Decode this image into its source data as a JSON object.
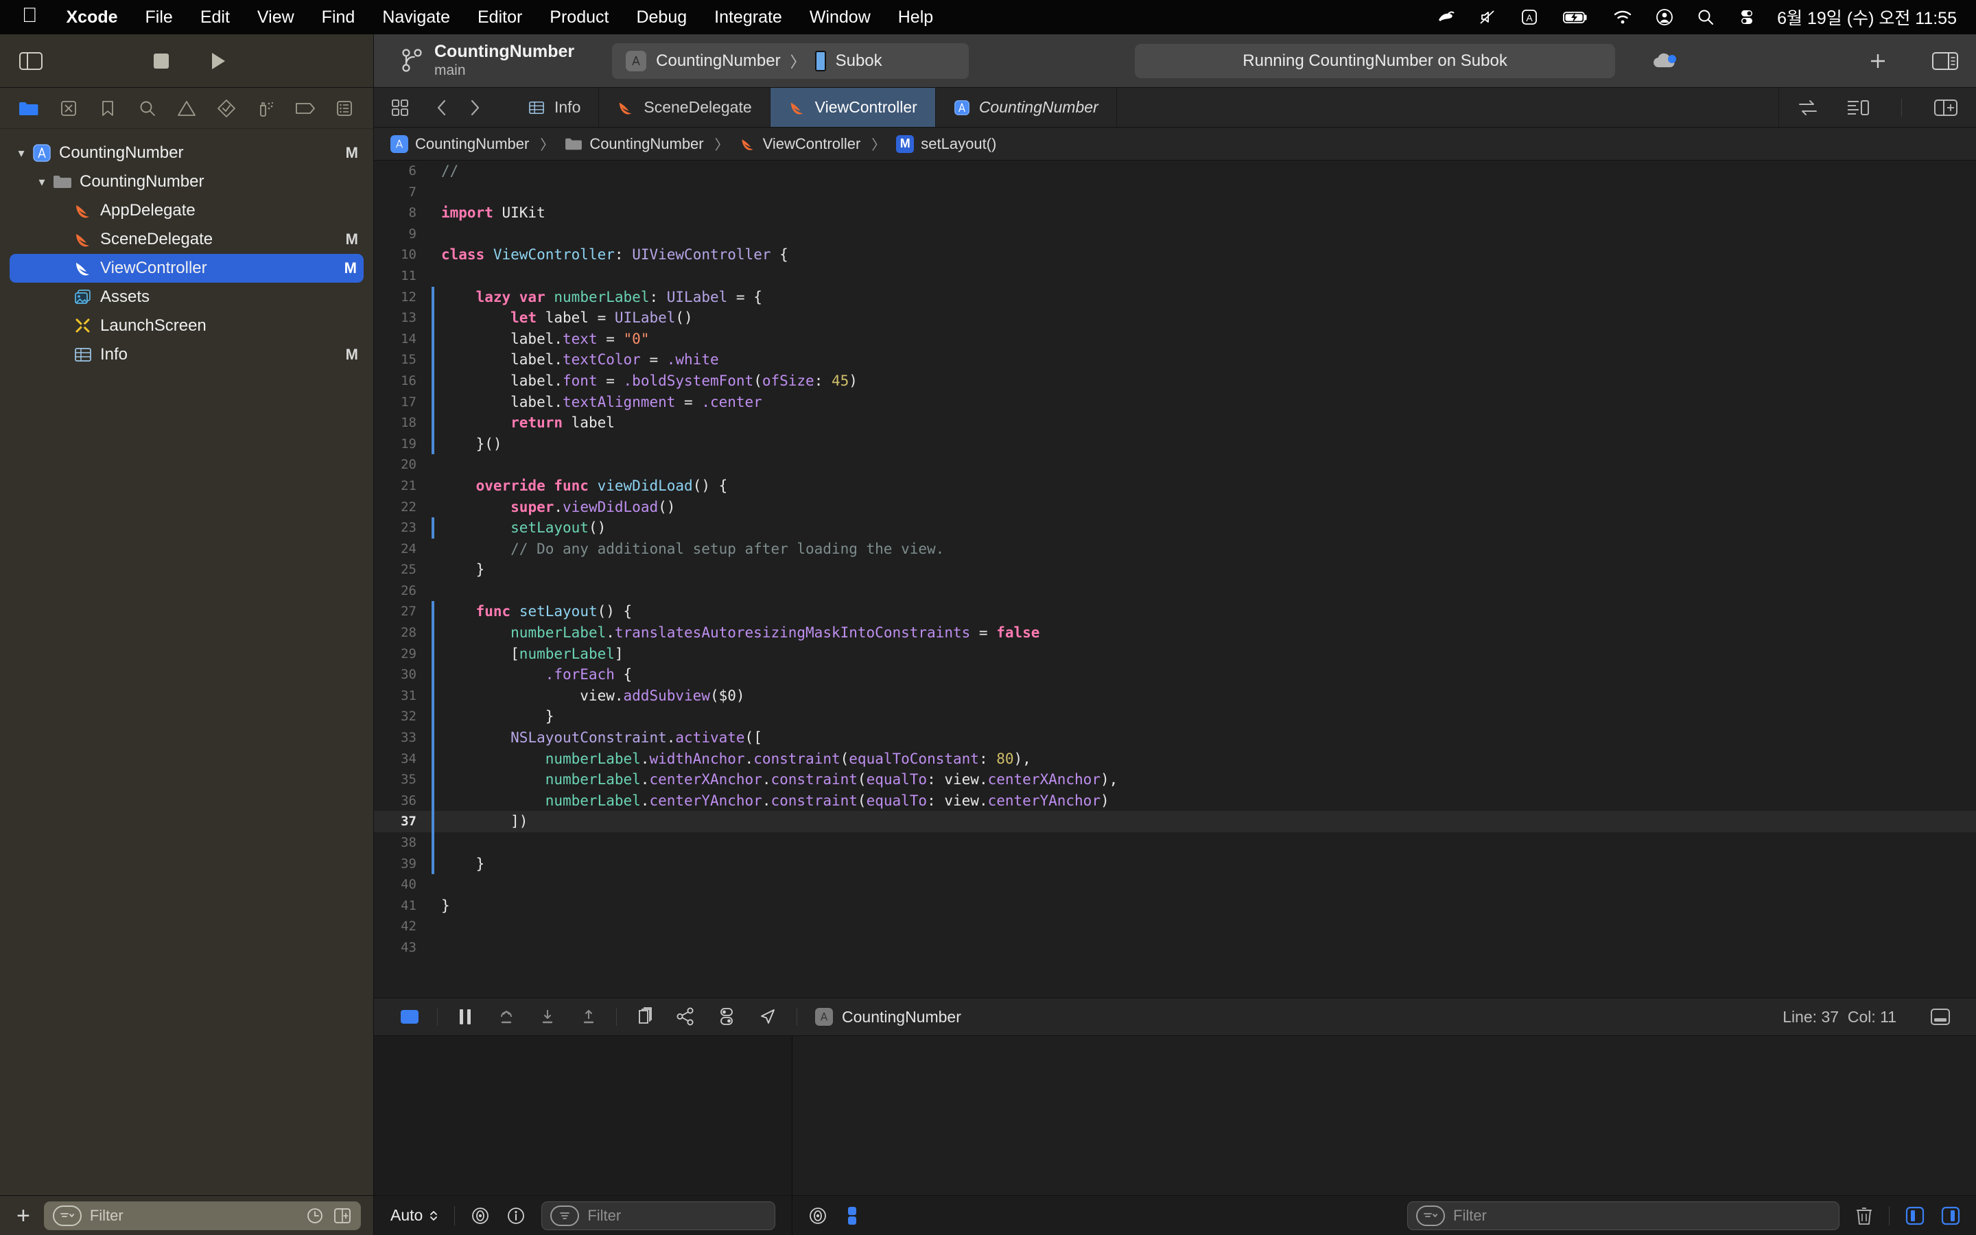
{
  "menubar": {
    "apple_icon": "apple-icon",
    "items": [
      {
        "label": "Xcode",
        "bold": true
      },
      {
        "label": "File",
        "bold": false
      },
      {
        "label": "Edit",
        "bold": false
      },
      {
        "label": "View",
        "bold": false
      },
      {
        "label": "Find",
        "bold": false
      },
      {
        "label": "Navigate",
        "bold": false
      },
      {
        "label": "Editor",
        "bold": false
      },
      {
        "label": "Product",
        "bold": false
      },
      {
        "label": "Debug",
        "bold": false
      },
      {
        "label": "Integrate",
        "bold": false
      },
      {
        "label": "Window",
        "bold": false
      },
      {
        "label": "Help",
        "bold": false
      }
    ],
    "status_icons": [
      "app-status-icon",
      "volume-mute-icon",
      "input-source-a-icon",
      "battery-charging-icon",
      "wifi-icon",
      "user-account-icon",
      "spotlight-search-icon",
      "control-center-icon"
    ],
    "clock": "6월 19일 (수) 오전 11:55"
  },
  "toolbar": {
    "sidebar_toggle": "toggle-navigator-icon",
    "stop_button": "stop-button",
    "run_button": "run-button",
    "scheme_icon": "branch-icon",
    "scheme_name": "CountingNumber",
    "scheme_branch": "main",
    "destination": {
      "app_icon": "xcode-app-icon",
      "app_name": "CountingNumber",
      "separator": "〉",
      "device_icon": "iphone-icon",
      "device_name": "Subok"
    },
    "status_text": "Running CountingNumber on Subok",
    "cloud_icon": "cloud-status-icon",
    "add_button": "add-icon",
    "inspector_toggle": "toggle-inspector-icon"
  },
  "navigator": {
    "tabs": [
      "project-navigator-icon",
      "source-control-navigator-icon",
      "bookmark-navigator-icon",
      "find-navigator-icon",
      "issue-navigator-icon",
      "test-navigator-icon",
      "debug-navigator-icon",
      "breakpoint-navigator-icon",
      "report-navigator-icon"
    ],
    "active_tab_index": 0,
    "tree": [
      {
        "label": "CountingNumber",
        "icon": "xcode-project-icon",
        "indent": 0,
        "twisty": "open",
        "modified": "M",
        "selected": false
      },
      {
        "label": "CountingNumber",
        "icon": "folder-icon",
        "indent": 1,
        "twisty": "open",
        "modified": "",
        "selected": false
      },
      {
        "label": "AppDelegate",
        "icon": "swift-file-icon",
        "indent": 2,
        "twisty": "",
        "modified": "",
        "selected": false
      },
      {
        "label": "SceneDelegate",
        "icon": "swift-file-icon",
        "indent": 2,
        "twisty": "",
        "modified": "M",
        "selected": false
      },
      {
        "label": "ViewController",
        "icon": "swift-file-icon",
        "indent": 2,
        "twisty": "",
        "modified": "M",
        "selected": true
      },
      {
        "label": "Assets",
        "icon": "assets-catalog-icon",
        "indent": 2,
        "twisty": "",
        "modified": "",
        "selected": false
      },
      {
        "label": "LaunchScreen",
        "icon": "storyboard-icon",
        "indent": 2,
        "twisty": "",
        "modified": "",
        "selected": false
      },
      {
        "label": "Info",
        "icon": "plist-icon",
        "indent": 2,
        "twisty": "",
        "modified": "M",
        "selected": false
      }
    ],
    "add_button": "add-file-button",
    "filter_placeholder": "Filter",
    "filter_value": "",
    "filter_trailing_icons": [
      "recent-files-icon",
      "source-control-filter-icon"
    ]
  },
  "editor": {
    "jump_bar_icons": [
      "related-items-icon",
      "back-icon",
      "forward-icon"
    ],
    "tabs": [
      {
        "label": "Info",
        "icon": "plist-icon",
        "active": false,
        "italic": false
      },
      {
        "label": "SceneDelegate",
        "icon": "swift-file-icon",
        "active": false,
        "italic": false
      },
      {
        "label": "ViewController",
        "icon": "swift-file-icon",
        "active": true,
        "italic": false
      },
      {
        "label": "CountingNumber",
        "icon": "xcode-project-icon",
        "active": false,
        "italic": true
      }
    ],
    "end_icons": [
      "code-review-icon",
      "split-editor-options-icon",
      "add-editor-icon"
    ],
    "breadcrumb": [
      {
        "label": "CountingNumber",
        "icon": "xcode-project-icon"
      },
      {
        "label": "CountingNumber",
        "icon": "folder-icon"
      },
      {
        "label": "ViewController",
        "icon": "swift-file-icon"
      },
      {
        "label": "setLayout()",
        "icon": "method-m-icon"
      }
    ],
    "breadcrumb_separator": "〉",
    "current_line": 37,
    "lines": [
      {
        "num": 6,
        "edited": false,
        "tokens": [
          {
            "t": "//",
            "c": "c"
          }
        ]
      },
      {
        "num": 7,
        "edited": false,
        "tokens": []
      },
      {
        "num": 8,
        "edited": false,
        "tokens": [
          {
            "t": "import",
            "c": "k"
          },
          {
            "t": " UIKit",
            "c": "pl"
          }
        ]
      },
      {
        "num": 9,
        "edited": false,
        "tokens": []
      },
      {
        "num": 10,
        "edited": false,
        "tokens": [
          {
            "t": "class",
            "c": "k"
          },
          {
            "t": " ",
            "c": "pl"
          },
          {
            "t": "ViewController",
            "c": "t"
          },
          {
            "t": ": ",
            "c": "pl"
          },
          {
            "t": "UIViewController",
            "c": "ty"
          },
          {
            "t": " {",
            "c": "pl"
          }
        ]
      },
      {
        "num": 11,
        "edited": false,
        "tokens": []
      },
      {
        "num": 12,
        "edited": true,
        "tokens": [
          {
            "t": "    ",
            "c": "pl"
          },
          {
            "t": "lazy var",
            "c": "k"
          },
          {
            "t": " ",
            "c": "pl"
          },
          {
            "t": "numberLabel",
            "c": "i"
          },
          {
            "t": ": ",
            "c": "pl"
          },
          {
            "t": "UILabel",
            "c": "ty"
          },
          {
            "t": " = {",
            "c": "pl"
          }
        ]
      },
      {
        "num": 13,
        "edited": true,
        "tokens": [
          {
            "t": "        ",
            "c": "pl"
          },
          {
            "t": "let",
            "c": "k"
          },
          {
            "t": " label = ",
            "c": "pl"
          },
          {
            "t": "UILabel",
            "c": "ty"
          },
          {
            "t": "()",
            "c": "pl"
          }
        ]
      },
      {
        "num": 14,
        "edited": true,
        "tokens": [
          {
            "t": "        label.",
            "c": "pl"
          },
          {
            "t": "text",
            "c": "p"
          },
          {
            "t": " = ",
            "c": "pl"
          },
          {
            "t": "\"0\"",
            "c": "s"
          }
        ]
      },
      {
        "num": 15,
        "edited": true,
        "tokens": [
          {
            "t": "        label.",
            "c": "pl"
          },
          {
            "t": "textColor",
            "c": "p"
          },
          {
            "t": " = ",
            "c": "pl"
          },
          {
            "t": ".white",
            "c": "p"
          }
        ]
      },
      {
        "num": 16,
        "edited": true,
        "tokens": [
          {
            "t": "        label.",
            "c": "pl"
          },
          {
            "t": "font",
            "c": "p"
          },
          {
            "t": " = ",
            "c": "pl"
          },
          {
            "t": ".boldSystemFont",
            "c": "p"
          },
          {
            "t": "(",
            "c": "pl"
          },
          {
            "t": "ofSize",
            "c": "p"
          },
          {
            "t": ": ",
            "c": "pl"
          },
          {
            "t": "45",
            "c": "n"
          },
          {
            "t": ")",
            "c": "pl"
          }
        ]
      },
      {
        "num": 17,
        "edited": true,
        "tokens": [
          {
            "t": "        label.",
            "c": "pl"
          },
          {
            "t": "textAlignment",
            "c": "p"
          },
          {
            "t": " = ",
            "c": "pl"
          },
          {
            "t": ".center",
            "c": "p"
          }
        ]
      },
      {
        "num": 18,
        "edited": true,
        "tokens": [
          {
            "t": "        ",
            "c": "pl"
          },
          {
            "t": "return",
            "c": "k"
          },
          {
            "t": " label",
            "c": "pl"
          }
        ]
      },
      {
        "num": 19,
        "edited": true,
        "tokens": [
          {
            "t": "    }()",
            "c": "pl"
          }
        ]
      },
      {
        "num": 20,
        "edited": false,
        "tokens": []
      },
      {
        "num": 21,
        "edited": false,
        "tokens": [
          {
            "t": "    ",
            "c": "pl"
          },
          {
            "t": "override func",
            "c": "k"
          },
          {
            "t": " ",
            "c": "pl"
          },
          {
            "t": "viewDidLoad",
            "c": "t"
          },
          {
            "t": "() {",
            "c": "pl"
          }
        ]
      },
      {
        "num": 22,
        "edited": false,
        "tokens": [
          {
            "t": "        ",
            "c": "pl"
          },
          {
            "t": "super",
            "c": "k"
          },
          {
            "t": ".",
            "c": "pl"
          },
          {
            "t": "viewDidLoad",
            "c": "p"
          },
          {
            "t": "()",
            "c": "pl"
          }
        ]
      },
      {
        "num": 23,
        "edited": true,
        "tokens": [
          {
            "t": "        ",
            "c": "pl"
          },
          {
            "t": "setLayout",
            "c": "i"
          },
          {
            "t": "()",
            "c": "pl"
          }
        ]
      },
      {
        "num": 24,
        "edited": false,
        "tokens": [
          {
            "t": "        ",
            "c": "pl"
          },
          {
            "t": "// Do any additional setup after loading the view.",
            "c": "c"
          }
        ]
      },
      {
        "num": 25,
        "edited": false,
        "tokens": [
          {
            "t": "    }",
            "c": "pl"
          }
        ]
      },
      {
        "num": 26,
        "edited": false,
        "tokens": []
      },
      {
        "num": 27,
        "edited": true,
        "tokens": [
          {
            "t": "    ",
            "c": "pl"
          },
          {
            "t": "func",
            "c": "k"
          },
          {
            "t": " ",
            "c": "pl"
          },
          {
            "t": "setLayout",
            "c": "t"
          },
          {
            "t": "() {",
            "c": "pl"
          }
        ]
      },
      {
        "num": 28,
        "edited": true,
        "tokens": [
          {
            "t": "        ",
            "c": "pl"
          },
          {
            "t": "numberLabel",
            "c": "i"
          },
          {
            "t": ".",
            "c": "pl"
          },
          {
            "t": "translatesAutoresizingMaskIntoConstraints",
            "c": "p"
          },
          {
            "t": " = ",
            "c": "pl"
          },
          {
            "t": "false",
            "c": "k"
          }
        ]
      },
      {
        "num": 29,
        "edited": true,
        "tokens": [
          {
            "t": "        [",
            "c": "pl"
          },
          {
            "t": "numberLabel",
            "c": "i"
          },
          {
            "t": "]",
            "c": "pl"
          }
        ]
      },
      {
        "num": 30,
        "edited": true,
        "tokens": [
          {
            "t": "            ",
            "c": "pl"
          },
          {
            "t": ".forEach",
            "c": "p"
          },
          {
            "t": " {",
            "c": "pl"
          }
        ]
      },
      {
        "num": 31,
        "edited": true,
        "tokens": [
          {
            "t": "                view.",
            "c": "pl"
          },
          {
            "t": "addSubview",
            "c": "p"
          },
          {
            "t": "(",
            "c": "pl"
          },
          {
            "t": "$0",
            "c": "pl"
          },
          {
            "t": ")",
            "c": "pl"
          }
        ]
      },
      {
        "num": 32,
        "edited": true,
        "tokens": [
          {
            "t": "            }",
            "c": "pl"
          }
        ]
      },
      {
        "num": 33,
        "edited": true,
        "tokens": [
          {
            "t": "        ",
            "c": "pl"
          },
          {
            "t": "NSLayoutConstraint",
            "c": "ty"
          },
          {
            "t": ".",
            "c": "pl"
          },
          {
            "t": "activate",
            "c": "p"
          },
          {
            "t": "([",
            "c": "pl"
          }
        ]
      },
      {
        "num": 34,
        "edited": true,
        "tokens": [
          {
            "t": "            ",
            "c": "pl"
          },
          {
            "t": "numberLabel",
            "c": "i"
          },
          {
            "t": ".",
            "c": "pl"
          },
          {
            "t": "widthAnchor",
            "c": "p"
          },
          {
            "t": ".",
            "c": "pl"
          },
          {
            "t": "constraint",
            "c": "p"
          },
          {
            "t": "(",
            "c": "pl"
          },
          {
            "t": "equalToConstant",
            "c": "p"
          },
          {
            "t": ": ",
            "c": "pl"
          },
          {
            "t": "80",
            "c": "n"
          },
          {
            "t": "),",
            "c": "pl"
          }
        ]
      },
      {
        "num": 35,
        "edited": true,
        "tokens": [
          {
            "t": "            ",
            "c": "pl"
          },
          {
            "t": "numberLabel",
            "c": "i"
          },
          {
            "t": ".",
            "c": "pl"
          },
          {
            "t": "centerXAnchor",
            "c": "p"
          },
          {
            "t": ".",
            "c": "pl"
          },
          {
            "t": "constraint",
            "c": "p"
          },
          {
            "t": "(",
            "c": "pl"
          },
          {
            "t": "equalTo",
            "c": "p"
          },
          {
            "t": ": view.",
            "c": "pl"
          },
          {
            "t": "centerXAnchor",
            "c": "p"
          },
          {
            "t": "),",
            "c": "pl"
          }
        ]
      },
      {
        "num": 36,
        "edited": true,
        "tokens": [
          {
            "t": "            ",
            "c": "pl"
          },
          {
            "t": "numberLabel",
            "c": "i"
          },
          {
            "t": ".",
            "c": "pl"
          },
          {
            "t": "centerYAnchor",
            "c": "p"
          },
          {
            "t": ".",
            "c": "pl"
          },
          {
            "t": "constraint",
            "c": "p"
          },
          {
            "t": "(",
            "c": "pl"
          },
          {
            "t": "equalTo",
            "c": "p"
          },
          {
            "t": ": view.",
            "c": "pl"
          },
          {
            "t": "centerYAnchor",
            "c": "p"
          },
          {
            "t": ")",
            "c": "pl"
          }
        ]
      },
      {
        "num": 37,
        "edited": true,
        "tokens": [
          {
            "t": "        ])",
            "c": "pl"
          }
        ]
      },
      {
        "num": 38,
        "edited": true,
        "tokens": []
      },
      {
        "num": 39,
        "edited": true,
        "tokens": [
          {
            "t": "    }",
            "c": "pl"
          }
        ]
      },
      {
        "num": 40,
        "edited": false,
        "tokens": []
      },
      {
        "num": 41,
        "edited": false,
        "tokens": [
          {
            "t": "}",
            "c": "pl"
          }
        ]
      },
      {
        "num": 42,
        "edited": false,
        "tokens": []
      },
      {
        "num": 43,
        "edited": false,
        "tokens": []
      }
    ]
  },
  "debugbar": {
    "icons": [
      "hide-debug-area-icon",
      "pause-button",
      "step-over-button",
      "step-into-button",
      "step-out-button",
      "view-hierarchy-button",
      "memory-graph-button",
      "environment-overrides-button",
      "simulate-location-button"
    ],
    "process_icon": "xcode-app-icon",
    "process_name": "CountingNumber",
    "line_label": "Line: 37",
    "col_label": "Col: 11",
    "minimap_toggle": "toggle-console-icon"
  },
  "bottombar": {
    "variables": {
      "scope_label": "Auto",
      "scope_chevron": "⌃⌄",
      "eye_icon": "watch-icon",
      "info_icon": "info-icon",
      "filter_placeholder": "Filter",
      "filter_value": ""
    },
    "console": {
      "eye_icon": "watch-icon",
      "split_icon": "console-split-icon",
      "filter_placeholder": "Filter",
      "filter_value": "",
      "trash_icon": "clear-console-icon",
      "left_pane_icon": "toggle-variables-view-icon",
      "right_pane_icon": "toggle-console-view-icon"
    }
  },
  "colors": {
    "accent": "#2f63d8",
    "tab_active": "#3e5775",
    "navigator_bg": "#33312a",
    "editor_bg": "#1f1f1f",
    "swift_orange": "#ef6c33"
  }
}
